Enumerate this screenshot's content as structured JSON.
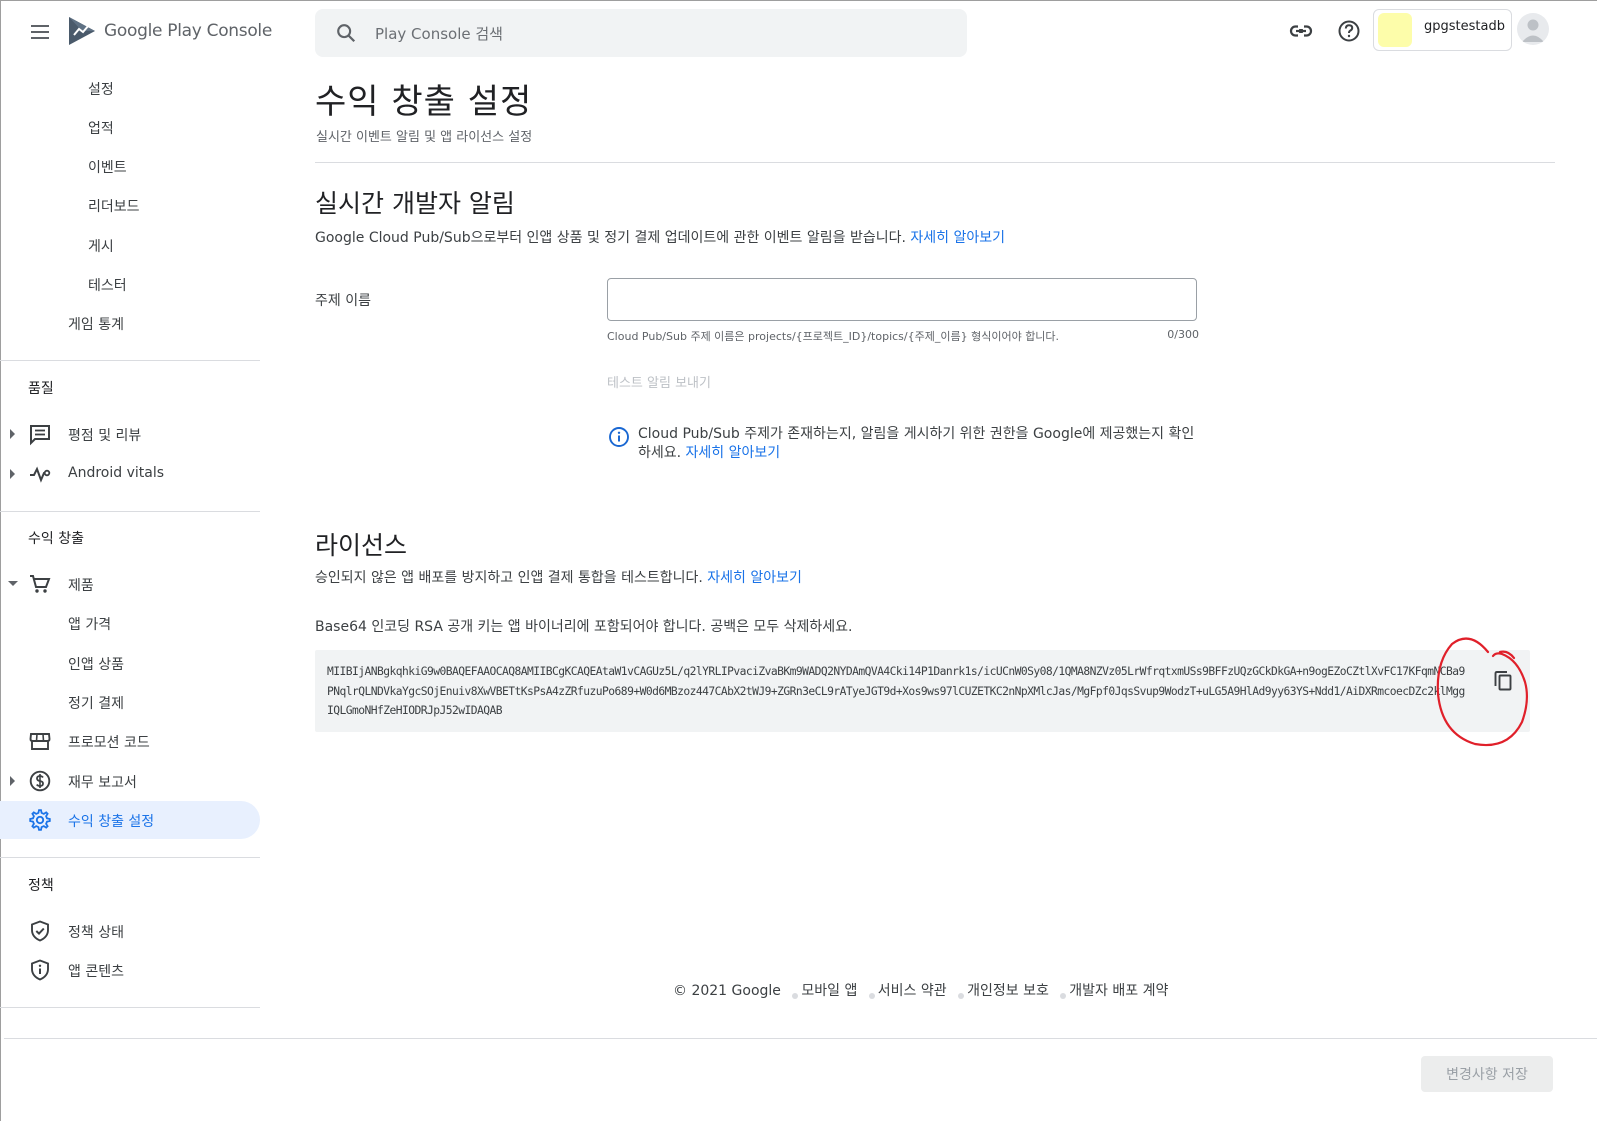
{
  "header": {
    "menu_icon": "hamburger-menu-icon",
    "logo_google": "Google Play",
    "logo_console": "Console",
    "search_placeholder": "Play Console 검색",
    "account_name": "gpgstestadb",
    "account_avatar_color": "#fdfdaa"
  },
  "sidebar": {
    "games_items": [
      "설정",
      "업적",
      "이벤트",
      "리더보드",
      "게시",
      "테스터"
    ],
    "game_stats": "게임 통계",
    "quality": {
      "title": "품질",
      "items": [
        "평점 및 리뷰",
        "Android vitals"
      ]
    },
    "monetize": {
      "title": "수익 창출",
      "products": "제품",
      "product_children": [
        "앱 가격",
        "인앱 상품",
        "정기 결제"
      ],
      "promo_codes": "프로모션 코드",
      "financial_reports": "재무 보고서",
      "monetization_setup": "수익 창출 설정"
    },
    "policy": {
      "title": "정책",
      "items": [
        "정책 상태",
        "앱 콘텐츠"
      ]
    }
  },
  "main": {
    "title": "수익 창출 설정",
    "subtitle": "실시간 이벤트 알림 및 앱 라이선스 설정",
    "rtdn": {
      "heading": "실시간 개발자 알림",
      "description": "Google Cloud Pub/Sub으로부터 인앱 상품 및 정기 결제 업데이트에 관한 이벤트 알림을 받습니다.",
      "learn_more": "자세히 알아보기",
      "topic_label": "주제 이름",
      "topic_value": "",
      "helper": "Cloud Pub/Sub 주제 이름은 projects/{프로젝트_ID}/topics/{주제_이름} 형식이어야 합니다.",
      "char_count": "0/300",
      "test_button": "테스트 알림 보내기",
      "info_text": "Cloud Pub/Sub 주제가 존재하는지, 알림을 게시하기 위한 권한을 Google에 제공했는지 확인하세요.",
      "info_learn_more": "자세히 알아보기"
    },
    "licensing": {
      "heading": "라이선스",
      "description": "승인되지 않은 앱 배포를 방지하고 인앱 결제 통합을 테스트합니다.",
      "learn_more": "자세히 알아보기",
      "key_label": "Base64 인코딩 RSA 공개 키는 앱 바이너리에 포함되어야 합니다. 공백은 모두 삭제하세요.",
      "public_key": "MIIBIjANBgkqhkiG9w0BAQEFAAOCAQ8AMIIBCgKCAQEAtaW1vCAGUz5L/q2lYRLIPvaciZvaBKm9WADQ2NYDAmQVA4Cki14P1Danrk1s/icUCnW0Sy08/1QMA8NZVz05LrWfrqtxmUSs9BFFzUQzGCkDkGA+n9ogEZoCZtlXvFC17KFqmNCBa9PNqlrQLNDVkaYgcSOjEnuiv8XwVBETtKsPsA4zZRfuzuPo689+W0d6MBzoz447CAbX2tWJ9+ZGRn3eCL9rATyeJGT9d+Xos9ws97lCUZETKC2nNpXMlcJas/MgFpf0JqsSvup9WodzT+uLG5A9HlAd9yy63YS+Ndd1/AiDXRmcoecDZc2klMggIQLGmoNHfZeHIODRJpJ52wIDAQAB",
      "copy_icon": "copy-content-icon",
      "annotation_color": "#e0202a"
    }
  },
  "footer": {
    "copyright": "© 2021 Google",
    "links": [
      "모바일 앱",
      "서비스 약관",
      "개인정보 보호",
      "개발자 배포 계약"
    ]
  },
  "actions": {
    "save_label": "변경사항 저장"
  }
}
